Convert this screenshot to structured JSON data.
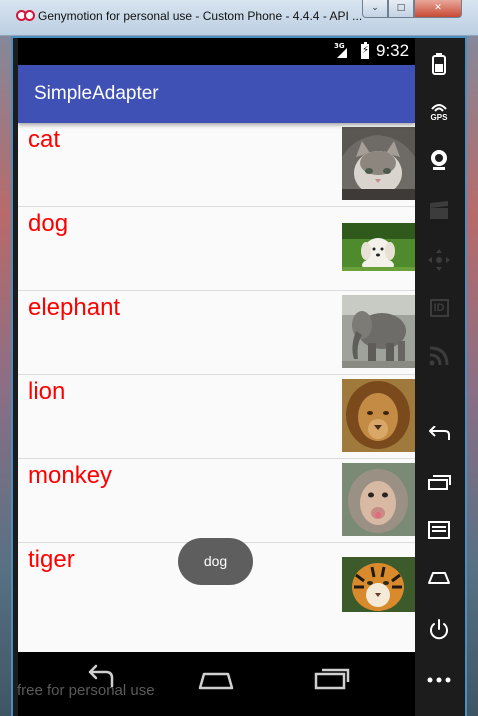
{
  "window": {
    "title": "Genymotion for personal use - Custom Phone - 4.4.4 - API ..."
  },
  "statusbar": {
    "network": "3G",
    "time": "9:32"
  },
  "actionbar": {
    "title": "SimpleAdapter"
  },
  "list": {
    "items": [
      {
        "label": "cat"
      },
      {
        "label": "dog"
      },
      {
        "label": "elephant"
      },
      {
        "label": "lion"
      },
      {
        "label": "monkey"
      },
      {
        "label": "tiger"
      }
    ]
  },
  "toast": {
    "text": "dog"
  },
  "toolbar": {
    "gps_label": "GPS",
    "id_label": "ID"
  },
  "watermark": {
    "text": "free for personal use"
  },
  "colors": {
    "accent": "#3f51b5",
    "item_text": "#ff0000"
  }
}
